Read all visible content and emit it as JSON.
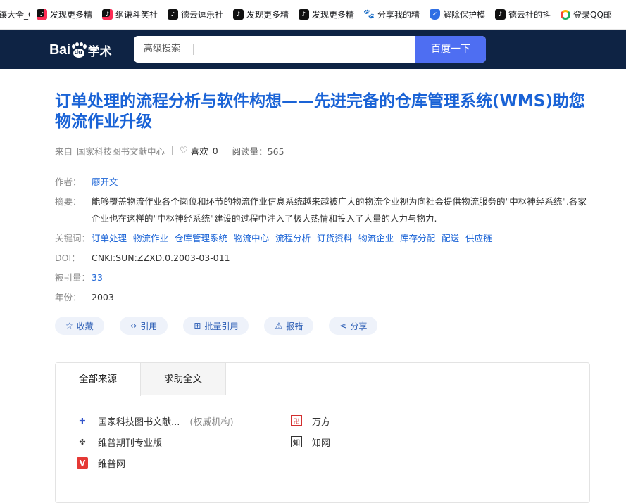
{
  "bookmarks": [
    {
      "label": "鑲大全_C",
      "icon": "none"
    },
    {
      "label": "发现更多精",
      "icon": "tiktok-icon"
    },
    {
      "label": "纲谦斗笑社",
      "icon": "tiktok-icon"
    },
    {
      "label": "德云逗乐社",
      "icon": "tiktok-icon"
    },
    {
      "label": "发现更多精",
      "icon": "tiktok-icon"
    },
    {
      "label": "发现更多精",
      "icon": "tiktok-icon"
    },
    {
      "label": "分享我的精",
      "icon": "baidu-icon"
    },
    {
      "label": "解除保护模",
      "icon": "shield-icon"
    },
    {
      "label": "德云社的抖",
      "icon": "tiktok-icon"
    },
    {
      "label": "登录QQ邮",
      "icon": "qq-icon"
    }
  ],
  "header": {
    "logo_text": "Bai",
    "logo_du": "du",
    "logo_suffix": "学术",
    "advanced_search": "高级搜索",
    "search_value": "",
    "search_button": "百度一下"
  },
  "article": {
    "title": "订单处理的流程分析与软件构想——先进完备的仓库管理系统(WMS)助您物流作业升级",
    "source_prefix": "来自",
    "source": "国家科技图书文献中心",
    "likes_label": "喜欢",
    "likes": "0",
    "reads_label": "阅读量：",
    "reads": "565",
    "author_label": "作者：",
    "author": "廖开文",
    "abstract_label": "摘要：",
    "abstract": "能够覆盖物流作业各个岗位和环节的物流作业信息系统越来越被广大的物流企业视为向社会提供物流服务的\"中枢神经系统\".各家企业也在这样的\"中枢神经系统\"建设的过程中注入了极大热情和投入了大量的人力与物力.",
    "keywords_label": "关键词：",
    "keywords": [
      "订单处理",
      "物流作业",
      "仓库管理系统",
      "物流中心",
      "流程分析",
      "订货资料",
      "物流企业",
      "库存分配",
      "配送",
      "供应链"
    ],
    "doi_label": "DOI：",
    "doi": "CNKI:SUN:ZZXD.0.2003-03-011",
    "cited_label": "被引量：",
    "cited": "33",
    "year_label": "年份：",
    "year": "2003"
  },
  "actions": [
    {
      "label": "收藏",
      "icon": "star-icon"
    },
    {
      "label": "引用",
      "icon": "code-icon"
    },
    {
      "label": "批量引用",
      "icon": "folder-plus-icon"
    },
    {
      "label": "报错",
      "icon": "warning-icon"
    },
    {
      "label": "分享",
      "icon": "share-icon"
    }
  ],
  "sources": {
    "tabs": [
      "全部来源",
      "求助全文"
    ],
    "items": [
      {
        "name": "国家科技图书文献...",
        "note": "(权威机构)",
        "icon": "nstl-icon"
      },
      {
        "name": "万方",
        "note": "",
        "icon": "wanfang-icon"
      },
      {
        "name": "维普期刊专业版",
        "note": "",
        "icon": "weipu-icon"
      },
      {
        "name": "知网",
        "note": "",
        "icon": "cnki-icon"
      },
      {
        "name": "维普网",
        "note": "",
        "icon": "weipunet-icon"
      }
    ]
  },
  "colors": {
    "header_bg": "#0e2344",
    "search_button": "#4e6ef2",
    "link": "#1a63d6",
    "pill_bg": "#eef2fa"
  }
}
